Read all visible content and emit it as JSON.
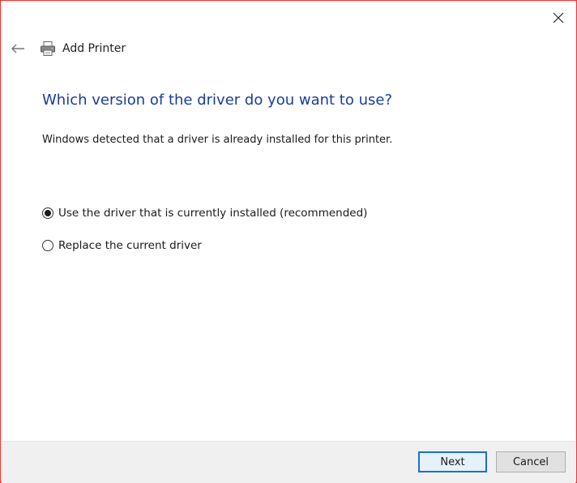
{
  "window": {
    "title": "Add Printer",
    "close_label": "×"
  },
  "page": {
    "heading": "Which version of the driver do you want to use?",
    "description": "Windows detected that a driver is already installed for this printer."
  },
  "options": [
    {
      "label": "Use the driver that is currently installed (recommended)",
      "selected": true
    },
    {
      "label": "Replace the current driver",
      "selected": false
    }
  ],
  "footer": {
    "next_label": "Next",
    "cancel_label": "Cancel"
  },
  "colors": {
    "heading": "#1a3b9c",
    "border": "#ff2a2a",
    "next_border": "#1e6fc9"
  },
  "icons": {
    "back": "back-arrow-icon",
    "close": "close-icon",
    "printer": "printer-icon"
  }
}
